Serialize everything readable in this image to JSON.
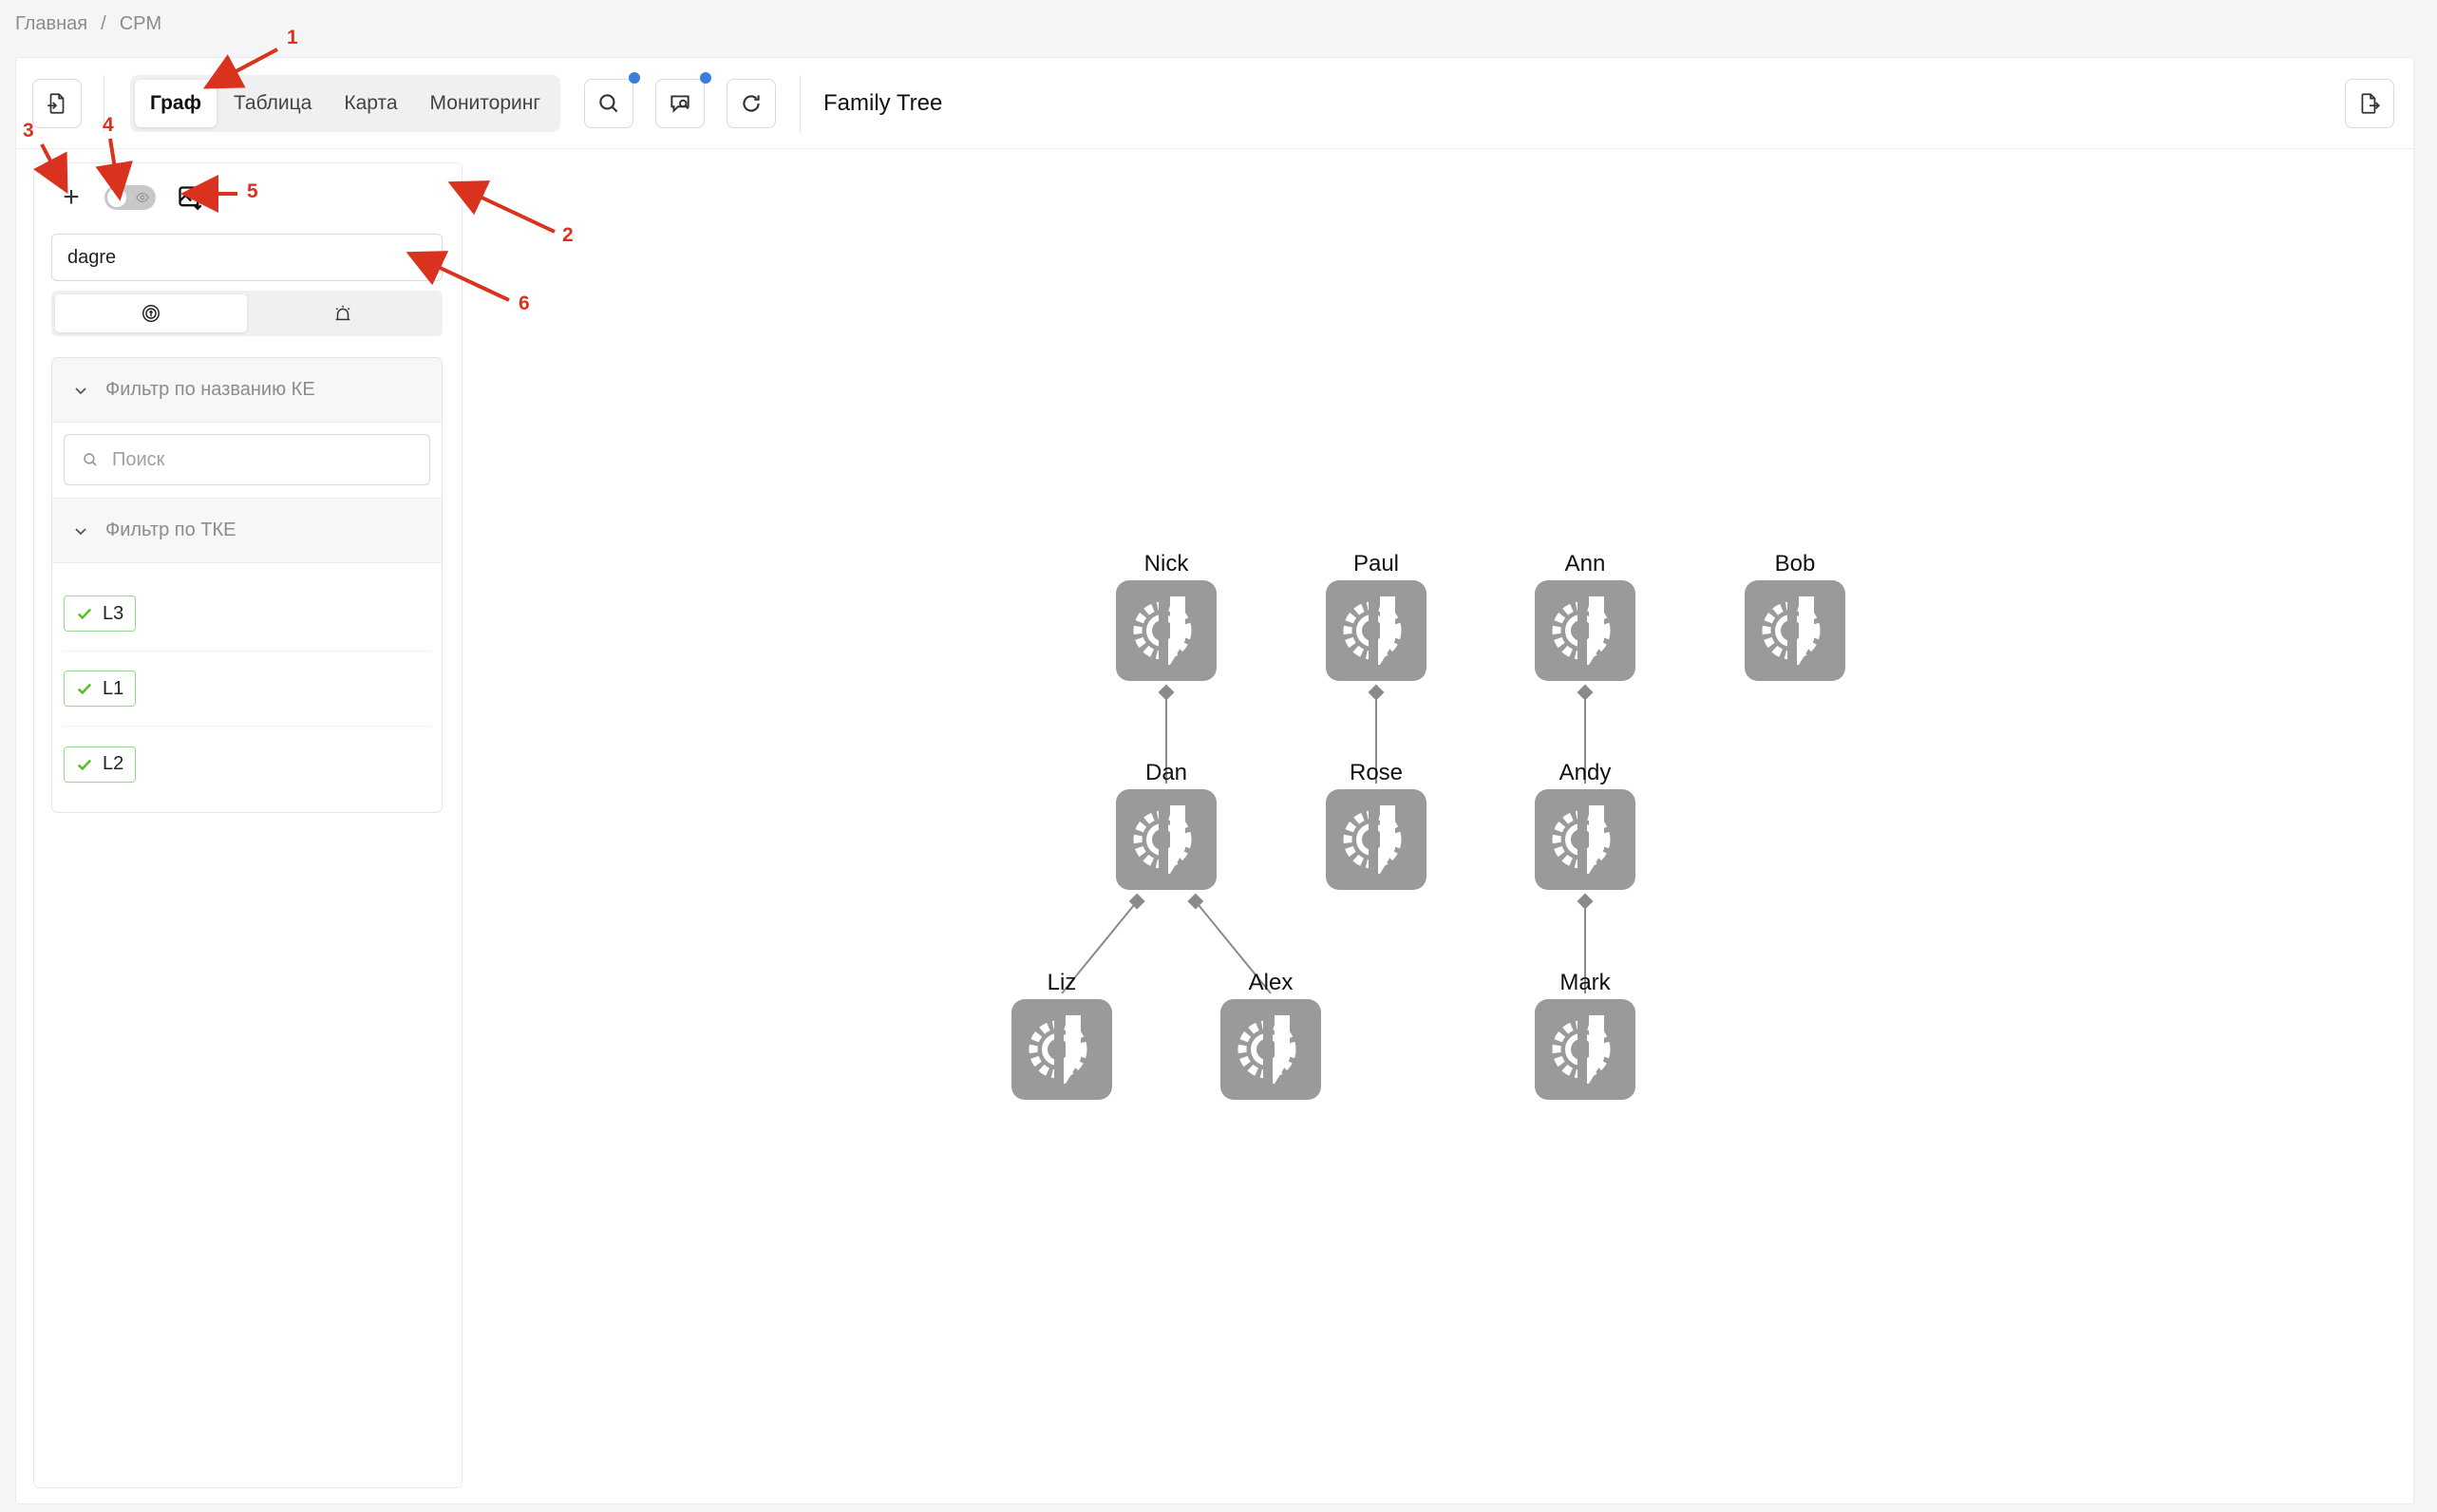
{
  "breadcrumb": {
    "home": "Главная",
    "separator": "/",
    "current": "CPM"
  },
  "toolbar": {
    "tabs": [
      {
        "label": "Граф",
        "active": true
      },
      {
        "label": "Таблица",
        "active": false
      },
      {
        "label": "Карта",
        "active": false
      },
      {
        "label": "Мониторинг",
        "active": false
      }
    ],
    "graph_title": "Family Tree",
    "icons": {
      "left": "file-import-icon",
      "search": "search-icon",
      "search_chat": "search-bubble-icon",
      "refresh": "refresh-icon",
      "right": "file-export-icon"
    },
    "badge_color": "#3b7ddd"
  },
  "sidebar": {
    "add_icon": "plus-icon",
    "toggle_icon": "eye-icon",
    "image_icon": "image-download-icon",
    "layout_select": {
      "value": "dagre"
    },
    "mode_icons": [
      "target-icon",
      "alarm-icon"
    ],
    "filter_name": {
      "title": "Фильтр по названию КЕ",
      "search_placeholder": "Поиск"
    },
    "filter_tke": {
      "title": "Фильтр по ТКЕ",
      "items": [
        "L3",
        "L1",
        "L2"
      ]
    },
    "tag_color": "#52c41a"
  },
  "graph": {
    "node_color": "#9a9a9a",
    "nodes": [
      {
        "id": "nick",
        "label": "Nick"
      },
      {
        "id": "paul",
        "label": "Paul"
      },
      {
        "id": "ann",
        "label": "Ann"
      },
      {
        "id": "bob",
        "label": "Bob"
      },
      {
        "id": "dan",
        "label": "Dan"
      },
      {
        "id": "rose",
        "label": "Rose"
      },
      {
        "id": "andy",
        "label": "Andy"
      },
      {
        "id": "liz",
        "label": "Liz"
      },
      {
        "id": "alex",
        "label": "Alex"
      },
      {
        "id": "mark",
        "label": "Mark"
      }
    ],
    "edges": [
      [
        "nick",
        "dan"
      ],
      [
        "paul",
        "rose"
      ],
      [
        "ann",
        "andy"
      ],
      [
        "andy",
        "mark"
      ],
      [
        "dan",
        "liz"
      ],
      [
        "dan",
        "alex"
      ]
    ]
  },
  "annotations": [
    "1",
    "2",
    "3",
    "4",
    "5",
    "6"
  ]
}
